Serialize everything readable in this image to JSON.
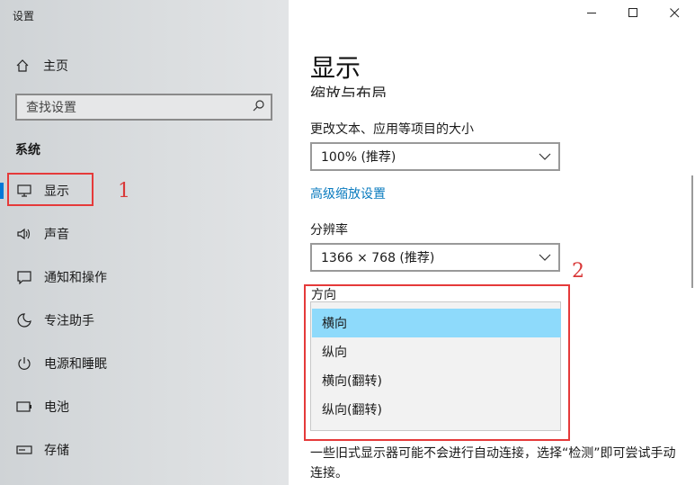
{
  "app": {
    "title": "设置"
  },
  "sidebar": {
    "home_label": "主页",
    "search_placeholder": "查找设置",
    "section_title": "系统",
    "items": [
      {
        "label": "显示",
        "icon": "monitor-icon",
        "active": true
      },
      {
        "label": "声音",
        "icon": "speaker-icon"
      },
      {
        "label": "通知和操作",
        "icon": "notification-icon"
      },
      {
        "label": "专注助手",
        "icon": "moon-icon"
      },
      {
        "label": "电源和睡眠",
        "icon": "power-icon"
      },
      {
        "label": "电池",
        "icon": "battery-icon"
      },
      {
        "label": "存储",
        "icon": "storage-icon"
      }
    ]
  },
  "annotations": {
    "one": "1",
    "two": "2"
  },
  "main": {
    "title": "显示",
    "clipped_heading": "缩放与布局",
    "scale": {
      "label": "更改文本、应用等项目的大小",
      "value": "100% (推荐)"
    },
    "advanced_link": "高级缩放设置",
    "resolution": {
      "label": "分辨率",
      "value": "1366 × 768 (推荐)"
    },
    "orientation": {
      "label": "方向",
      "options": [
        "横向",
        "纵向",
        "横向(翻转)",
        "纵向(翻转)"
      ],
      "selected": "横向"
    },
    "note": "一些旧式显示器可能不会进行自动连接，选择“检测”即可尝试手动连接。"
  },
  "colors": {
    "accent": "#0078d7",
    "selected_option": "#8edafb",
    "link": "#0a7bbf",
    "annotation": "#e53a3a"
  }
}
